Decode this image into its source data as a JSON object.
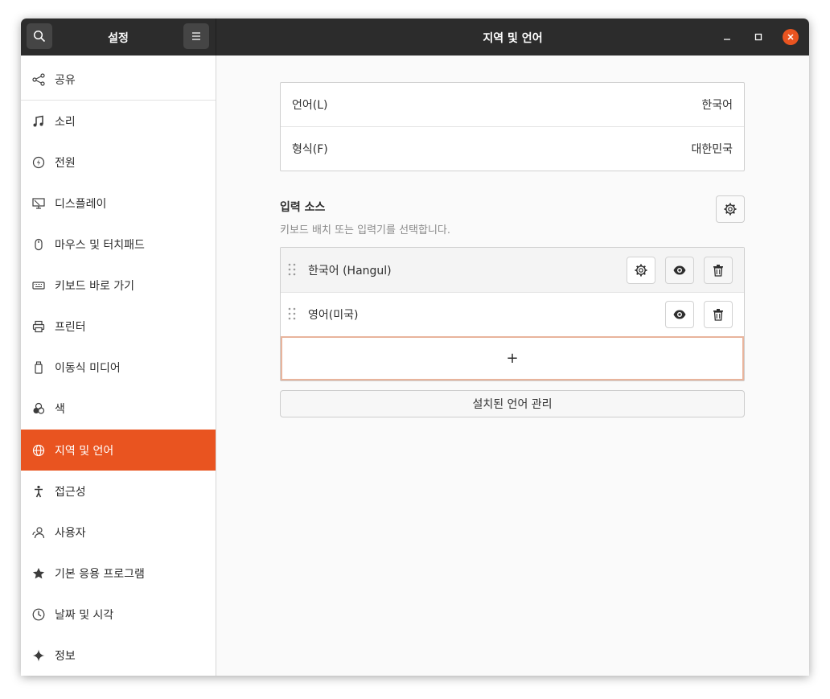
{
  "titlebar": {
    "left_title": "설정",
    "main_title": "지역 및 언어",
    "search_icon": "search-icon",
    "menu_icon": "hamburger-menu-icon"
  },
  "sidebar": {
    "items": [
      {
        "label": "공유",
        "icon": "share-icon"
      },
      {
        "label": "소리",
        "icon": "music-note-icon"
      },
      {
        "label": "전원",
        "icon": "power-icon"
      },
      {
        "label": "디스플레이",
        "icon": "display-icon"
      },
      {
        "label": "마우스 및 터치패드",
        "icon": "mouse-icon"
      },
      {
        "label": "키보드 바로 가기",
        "icon": "keyboard-icon"
      },
      {
        "label": "프린터",
        "icon": "printer-icon"
      },
      {
        "label": "이동식 미디어",
        "icon": "removable-media-icon"
      },
      {
        "label": "색",
        "icon": "color-icon"
      },
      {
        "label": "지역 및 언어",
        "icon": "globe-icon",
        "active": true
      },
      {
        "label": "접근성",
        "icon": "accessibility-icon"
      },
      {
        "label": "사용자",
        "icon": "users-icon"
      },
      {
        "label": "기본 응용 프로그램",
        "icon": "star-icon"
      },
      {
        "label": "날짜 및 시각",
        "icon": "clock-icon"
      },
      {
        "label": "정보",
        "icon": "sparkle-icon"
      }
    ]
  },
  "region": {
    "language_label": "언어(L)",
    "language_value": "한국어",
    "formats_label": "형식(F)",
    "formats_value": "대한민국"
  },
  "input_sources": {
    "title": "입력 소스",
    "subtitle": "키보드 배치 또는 입력기를 선택합니다.",
    "sources": [
      {
        "label": "한국어 (Hangul)"
      },
      {
        "label": "영어(미국)"
      }
    ],
    "add_label": "+"
  },
  "manage_button": "설치된 언어 관리",
  "colors": {
    "accent": "#e95420",
    "titlebar": "#2c2c2c"
  }
}
